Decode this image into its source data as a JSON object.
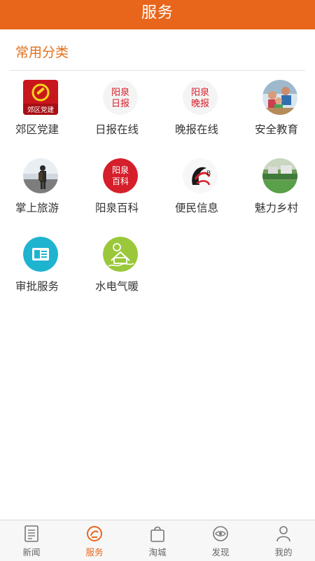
{
  "header": {
    "title": "服务"
  },
  "section": {
    "title": "常用分类"
  },
  "categories": [
    {
      "label": "郊区党建",
      "icon": "party-building-icon",
      "badge": "郊区党建"
    },
    {
      "label": "日报在线",
      "icon": "daily-news-icon",
      "badge_l1": "阳泉",
      "badge_l2": "日报"
    },
    {
      "label": "晚报在线",
      "icon": "evening-news-icon",
      "badge_l1": "阳泉",
      "badge_l2": "晚报"
    },
    {
      "label": "安全教育",
      "icon": "safety-education-icon"
    },
    {
      "label": "掌上旅游",
      "icon": "travel-icon"
    },
    {
      "label": "阳泉百科",
      "icon": "encyclopedia-icon",
      "badge_l1": "阳泉",
      "badge_l2": "百科"
    },
    {
      "label": "便民信息",
      "icon": "convenience-info-icon"
    },
    {
      "label": "魅力乡村",
      "icon": "charming-village-icon"
    },
    {
      "label": "审批服务",
      "icon": "approval-service-icon"
    },
    {
      "label": "水电气暖",
      "icon": "utilities-icon"
    }
  ],
  "tabs": [
    {
      "label": "新闻",
      "icon": "news-icon",
      "active": false
    },
    {
      "label": "服务",
      "icon": "service-icon",
      "active": true
    },
    {
      "label": "淘城",
      "icon": "shopping-bag-icon",
      "active": false
    },
    {
      "label": "发现",
      "icon": "discover-icon",
      "active": false
    },
    {
      "label": "我的",
      "icon": "profile-icon",
      "active": false
    }
  ],
  "colors": {
    "accent": "#e8661b",
    "text": "#333333",
    "tab_inactive": "#666666"
  }
}
